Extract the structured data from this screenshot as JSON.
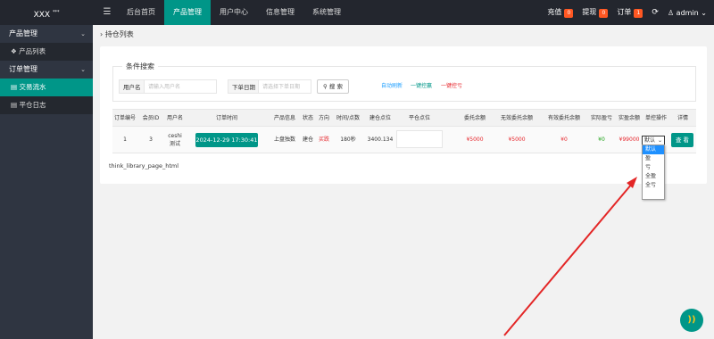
{
  "header": {
    "logo": "XXX",
    "logo_sup": "***",
    "nav": [
      {
        "label": "后台首页",
        "active": false
      },
      {
        "label": "产品管理",
        "active": true
      },
      {
        "label": "用户中心",
        "active": false
      },
      {
        "label": "信息管理",
        "active": false
      },
      {
        "label": "系统管理",
        "active": false
      }
    ],
    "recharge": {
      "label": "充值",
      "count": "0",
      "color": "#ff5722"
    },
    "withdraw": {
      "label": "提现",
      "count": "0",
      "color": "#ff5722"
    },
    "orders": {
      "label": "订单",
      "count": "1",
      "color": "#ff5722"
    },
    "user": "admin"
  },
  "sidebar": {
    "groups": [
      {
        "label": "产品管理",
        "items": [
          {
            "label": "产品列表",
            "active": false
          }
        ]
      },
      {
        "label": "订单管理",
        "items": [
          {
            "label": "交易流水",
            "active": true
          },
          {
            "label": "平仓日志",
            "active": false
          }
        ]
      }
    ]
  },
  "breadcrumb": "持仓列表",
  "filter": {
    "legend": "条件搜索",
    "username_label": "用户名",
    "username_placeholder": "请输入用户名",
    "date_label": "下单日期",
    "date_placeholder": "请选择下单日期",
    "search_label": "搜 索",
    "auto_refresh": "自动刷新",
    "all_win": "一键控赢",
    "all_lose": "一键控亏"
  },
  "table": {
    "headers": [
      "订单编号",
      "会员ID",
      "用户名",
      "订单时间",
      "产品信息",
      "状态",
      "方向",
      "时间/点数",
      "建仓点位",
      "平仓点位",
      "委托余额",
      "无效委托余额",
      "有效委托余额",
      "实际盈亏",
      "实盈余额",
      "单控操作",
      "详情"
    ],
    "row": {
      "order_no": "1",
      "member_id": "3",
      "username": "ceshi",
      "username2": "测试",
      "time": "2024-12-29 17:30:41",
      "product": "上盘独数",
      "status": "建仓",
      "direction": "买跌",
      "duration": "180秒",
      "open_price": "3400.134",
      "close_price": "",
      "entrust": "¥5000",
      "invalid_entrust": "¥5000",
      "valid_entrust": "¥0",
      "actual_pnl": "¥0",
      "real_balance": "¥99000",
      "control_value": "默认",
      "view_label": "查 看"
    }
  },
  "dropdown_options": [
    "默认",
    "盈",
    "亏",
    "全盈",
    "全亏"
  ],
  "pager_text": "think_library_page_html",
  "colors": {
    "accent": "#009688",
    "topbar": "#23262e",
    "sidebar": "#2f3541",
    "arrow": "#e32626"
  }
}
